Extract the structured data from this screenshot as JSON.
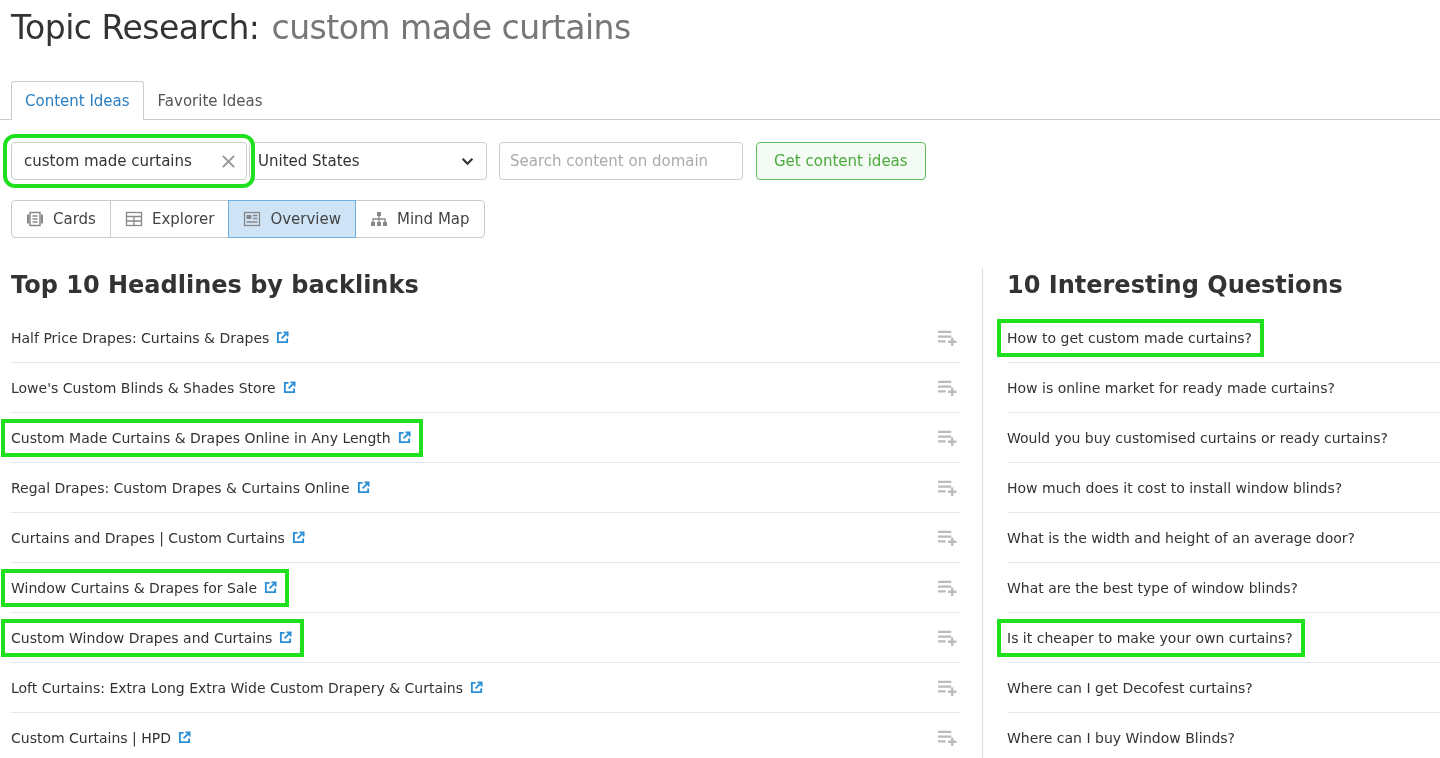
{
  "title": {
    "prefix": "Topic Research:",
    "topic": "custom made curtains"
  },
  "tabs": [
    {
      "label": "Content Ideas",
      "selected": true
    },
    {
      "label": "Favorite Ideas",
      "selected": false
    }
  ],
  "search": {
    "value": "custom made curtains",
    "highlighted": true,
    "country": "United States",
    "domain_placeholder": "Search content on domain",
    "button": "Get content ideas"
  },
  "views": [
    {
      "label": "Cards",
      "selected": false
    },
    {
      "label": "Explorer",
      "selected": false
    },
    {
      "label": "Overview",
      "selected": true
    },
    {
      "label": "Mind Map",
      "selected": false
    }
  ],
  "headlines": {
    "title": "Top 10 Headlines by backlinks",
    "items": [
      {
        "text": "Half Price Drapes: Curtains & Drapes",
        "highlighted": false
      },
      {
        "text": "Lowe's Custom Blinds & Shades Store",
        "highlighted": false
      },
      {
        "text": "Custom Made Curtains & Drapes Online in Any Length",
        "highlighted": true
      },
      {
        "text": "Regal Drapes: Custom Drapes & Curtains Online",
        "highlighted": false
      },
      {
        "text": "Curtains and Drapes | Custom Curtains",
        "highlighted": false
      },
      {
        "text": "Window Curtains & Drapes for Sale",
        "highlighted": true
      },
      {
        "text": "Custom Window Drapes and Curtains",
        "highlighted": true
      },
      {
        "text": "Loft Curtains: Extra Long Extra Wide Custom Drapery & Curtains",
        "highlighted": false
      },
      {
        "text": "Custom Curtains | HPD",
        "highlighted": false
      }
    ]
  },
  "questions": {
    "title": "10 Interesting Questions",
    "items": [
      {
        "text": "How to get custom made curtains?",
        "highlighted": true
      },
      {
        "text": "How is online market for ready made curtains?",
        "highlighted": false
      },
      {
        "text": "Would you buy customised curtains or ready curtains?",
        "highlighted": false
      },
      {
        "text": "How much does it cost to install window blinds?",
        "highlighted": false
      },
      {
        "text": "What is the width and height of an average door?",
        "highlighted": false
      },
      {
        "text": "What are the best type of window blinds?",
        "highlighted": false
      },
      {
        "text": "Is it cheaper to make your own curtains?",
        "highlighted": true
      },
      {
        "text": "Where can I get Decofest curtains?",
        "highlighted": false
      },
      {
        "text": "Where can I buy Window Blinds?",
        "highlighted": false
      }
    ]
  }
}
